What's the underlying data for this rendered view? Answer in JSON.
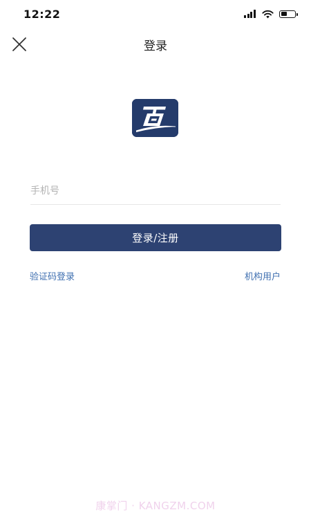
{
  "status_bar": {
    "time": "12:22",
    "battery_level": 0.45
  },
  "nav": {
    "title": "登录",
    "close_icon": "close-icon"
  },
  "logo": {
    "icon": "app-logo-icon",
    "background_color": "#243b6b"
  },
  "form": {
    "phone_placeholder": "手机号",
    "phone_value": "",
    "login_button_label": "登录/注册",
    "button_color": "#2d4272"
  },
  "links": {
    "sms_login": "验证码登录",
    "org_user": "机构用户",
    "link_color": "#3f6fb0"
  },
  "watermark": {
    "text": "康掌门 · KANGZM.COM"
  }
}
